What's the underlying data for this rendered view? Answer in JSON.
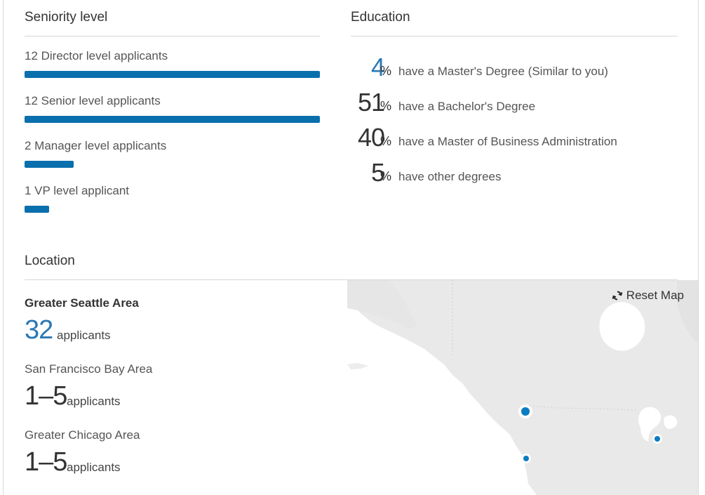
{
  "seniority": {
    "title": "Seniority level",
    "items": [
      {
        "label": "12 Director level applicants",
        "value": 12
      },
      {
        "label": "12 Senior level applicants",
        "value": 12
      },
      {
        "label": "2 Manager level applicants",
        "value": 2
      },
      {
        "label": "1 VP level applicant",
        "value": 1
      }
    ],
    "bar_color": "#0a6fad"
  },
  "education": {
    "title": "Education",
    "items": [
      {
        "value": "4",
        "unit": "%",
        "text": "have a Master's Degree (Similar to you)",
        "highlight": true
      },
      {
        "value": "51",
        "unit": "%",
        "text": "have a Bachelor's Degree",
        "highlight": false
      },
      {
        "value": "40",
        "unit": "%",
        "text": "have a Master of Business Administration",
        "highlight": false
      },
      {
        "value": "5",
        "unit": "%",
        "text": "have other degrees",
        "highlight": false
      }
    ]
  },
  "location": {
    "title": "Location",
    "items": [
      {
        "name": "Greater Seattle Area",
        "count": "32",
        "unit": "applicants"
      },
      {
        "name": "San Francisco Bay Area",
        "count": "1–5",
        "unit": "applicants"
      },
      {
        "name": "Greater Chicago Area",
        "count": "1–5",
        "unit": "applicants"
      }
    ],
    "map": {
      "reset_label": "Reset Map",
      "marker_color": "#0a7cc1"
    }
  },
  "colors": {
    "accent": "#2a78b4",
    "bar": "#0a6fad",
    "rule": "#d6d6d6",
    "land": "#e9e9e9",
    "water": "#ffffff"
  }
}
